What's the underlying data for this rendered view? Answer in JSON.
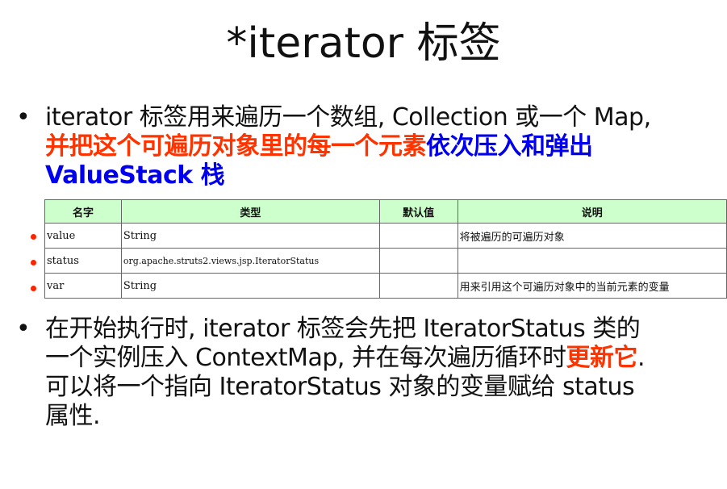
{
  "title": "*iterator 标签",
  "bullet1": {
    "line1": "iterator 标签用来遍历一个数组, Collection 或一个 Map,",
    "line2_red": "并把这个可遍历对象里的每一个元素",
    "line2_blue": "依次压入和弹出",
    "line3_blue": "ValueStack 栈"
  },
  "table": {
    "headers": [
      "名字",
      "类型",
      "默认值",
      "说明"
    ],
    "rows": [
      {
        "name": "value",
        "type": "String",
        "default": "",
        "desc": "将被遍历的可遍历对象"
      },
      {
        "name": "status",
        "type": "org.apache.struts2.views.jsp.IteratorStatus",
        "default": "",
        "desc": ""
      },
      {
        "name": "var",
        "type": "String",
        "default": "",
        "desc": "用来引用这个可遍历对象中的当前元素的变量"
      }
    ]
  },
  "bullet2": {
    "line1": "在开始执行时, iterator 标签会先把 IteratorStatus 类的",
    "line2_a": "一个实例压入 ContextMap, 并在每次遍历循环时",
    "line2_red": "更新它",
    "line2_b": ".",
    "line3": "可以将一个指向 IteratorStatus 对象的变量赋给 status",
    "line4": "属性."
  },
  "colors": {
    "accent_red": "#ff3300",
    "accent_blue": "#0000ee",
    "header_bg": "#ccffcc"
  }
}
